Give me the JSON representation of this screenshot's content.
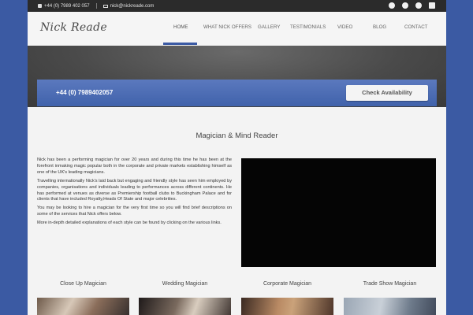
{
  "topbar": {
    "phone": "+44 (0) 7989 402 057",
    "email": "nick@nickreade.com",
    "social_icons": [
      "facebook-icon",
      "twitter-icon",
      "pinterest-icon",
      "linkedin-icon"
    ]
  },
  "header": {
    "logo_text": "Nick Reade",
    "nav": [
      "HOME",
      "WHAT NICK OFFERS",
      "GALLERY",
      "TESTIMONIALS",
      "VIDEO",
      "BLOG",
      "CONTACT"
    ],
    "active_nav": "HOME"
  },
  "banner": {
    "phone": "+44 (0) 7989402057",
    "button_label": "Check Availability"
  },
  "main": {
    "title": "Magician & Mind Reader",
    "paragraphs": [
      "Nick has been a performing magician for over 20 years and during this time he has been at the forefront inmaking magic popular both in the corporate and private markets establishing himself as one of the UK's leading magicians.",
      "Travelling internationally Nick's laid back but engaging and friendly style has seen him employed by companies, organisations and individuals leading to performances across different continents. He has performed at venues as diverse as Premiership football clubs to Buckingham Palace and for clients that have included Royalty,Heads Of State and major celebrities.",
      "You may be looking to hire a magician for the very first time so you will find brief descriptions on some of the services that Nick offers below.",
      "More in-depth detailed explanations of each style can be found by clicking on the various links."
    ]
  },
  "services": [
    "Close Up Magician",
    "Wedding Magician",
    "Corporate Magician",
    "Trade Show Magician"
  ],
  "colors": {
    "accent": "#3b5aa3",
    "topbar": "#2b2b2b",
    "banner": "#4a6bb3",
    "video_bg": "#050505"
  }
}
